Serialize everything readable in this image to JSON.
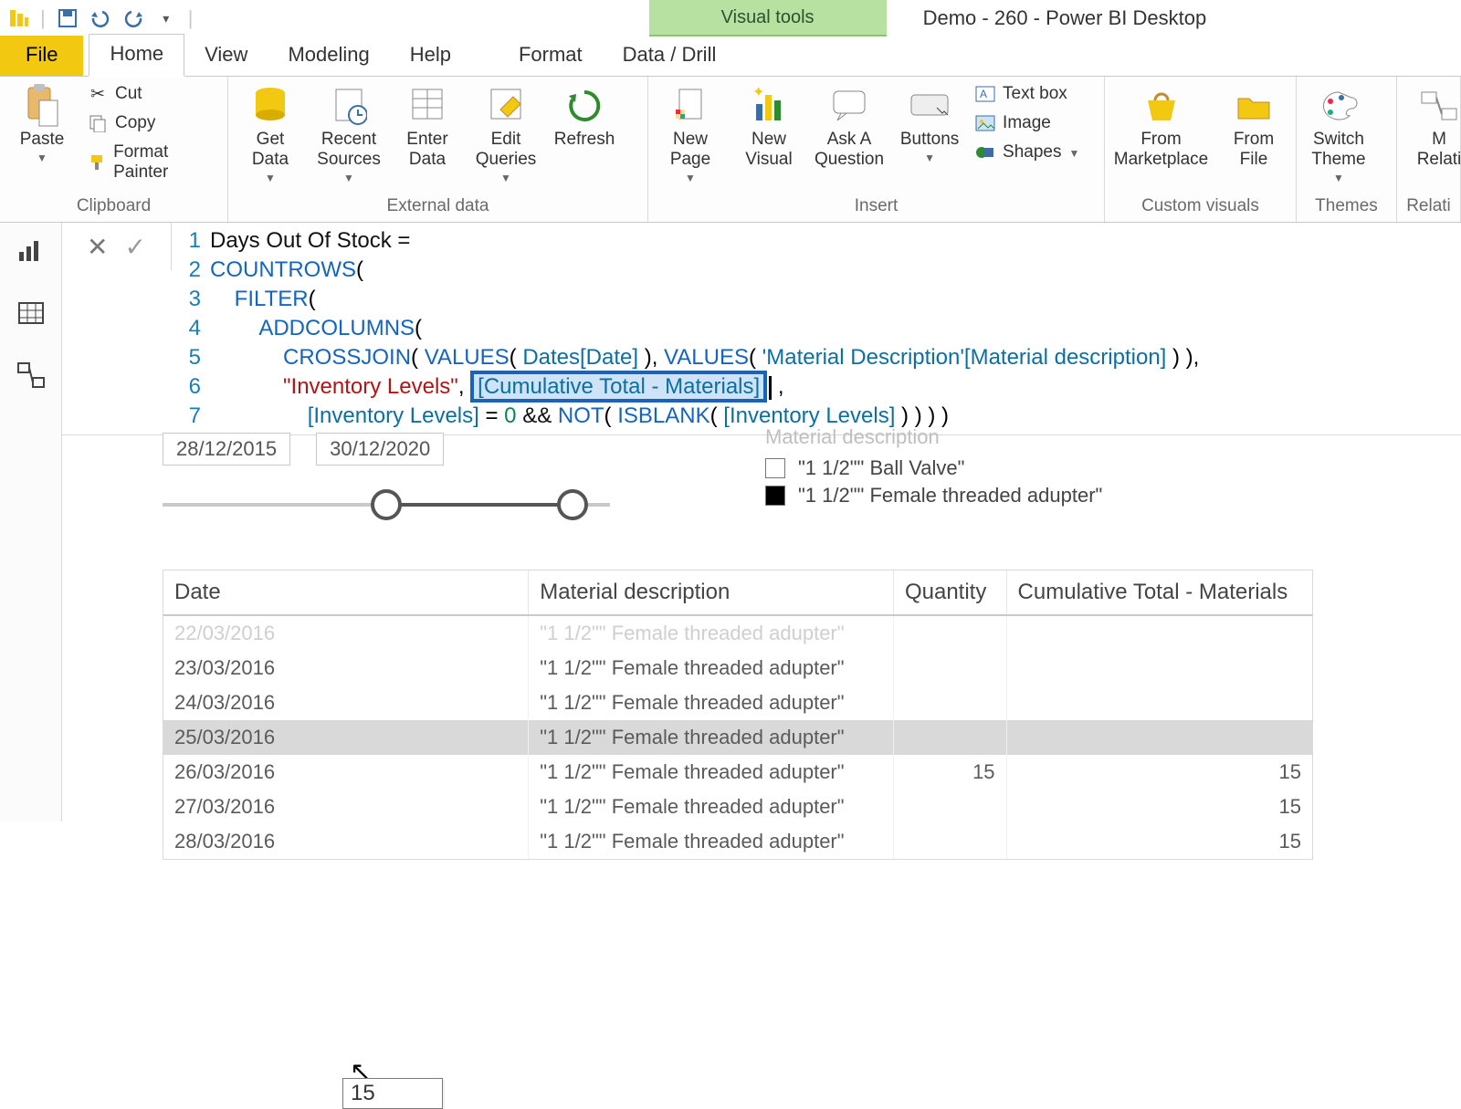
{
  "titlebar": {
    "tool_tab": "Visual tools",
    "doc_title": "Demo - 260 - Power BI Desktop"
  },
  "tabs": {
    "file": "File",
    "home": "Home",
    "view": "View",
    "modeling": "Modeling",
    "help": "Help",
    "format": "Format",
    "data_drill": "Data / Drill"
  },
  "ribbon": {
    "clipboard": {
      "label": "Clipboard",
      "paste": "Paste",
      "cut": "Cut",
      "copy": "Copy",
      "format_painter": "Format Painter"
    },
    "external": {
      "label": "External data",
      "get_data": "Get\nData",
      "recent_sources": "Recent\nSources",
      "enter_data": "Enter\nData",
      "edit_queries": "Edit\nQueries",
      "refresh": "Refresh"
    },
    "insert": {
      "label": "Insert",
      "new_page": "New\nPage",
      "new_visual": "New\nVisual",
      "ask_q": "Ask A\nQuestion",
      "buttons": "Buttons",
      "text_box": "Text box",
      "image": "Image",
      "shapes": "Shapes"
    },
    "custom_visuals": {
      "label": "Custom visuals",
      "from_marketplace": "From\nMarketplace",
      "from_file": "From\nFile"
    },
    "themes": {
      "label": "Themes",
      "switch_theme": "Switch\nTheme"
    },
    "relationships": {
      "label": "Relati",
      "manage": "M\nRelati"
    }
  },
  "formula": {
    "line1": "Days Out Of Stock =",
    "countrows": "COUNTROWS",
    "filter": "FILTER",
    "addcolumns": "ADDCOLUMNS",
    "crossjoin": "CROSSJOIN",
    "values": "VALUES",
    "dates_ref": "Dates[Date]",
    "mat_table": "'Material Description'",
    "mat_col": "[Material description]",
    "inv_label": "\"Inventory Levels\"",
    "cum_measure": "[Cumulative Total - Materials]",
    "inv_col": "[Inventory Levels]",
    "zero": "0",
    "and": "&&",
    "not": "NOT",
    "isblank": "ISBLANK"
  },
  "slicer": {
    "start": "28/12/2015",
    "end": "30/12/2020"
  },
  "legend": {
    "header": "Material description",
    "item1": "\"1 1/2\"\" Ball Valve\"",
    "item2": "\"1 1/2\"\" Female threaded adupter\""
  },
  "table": {
    "headers": {
      "date": "Date",
      "mat": "Material description",
      "qty": "Quantity",
      "cum": "Cumulative Total - Materials"
    },
    "rows": [
      {
        "date": "22/03/2016",
        "mat": "\"1 1/2\"\" Female threaded adupter\"",
        "qty": "",
        "cum": "",
        "cutoff": true
      },
      {
        "date": "23/03/2016",
        "mat": "\"1 1/2\"\" Female threaded adupter\"",
        "qty": "",
        "cum": ""
      },
      {
        "date": "24/03/2016",
        "mat": "\"1 1/2\"\" Female threaded adupter\"",
        "qty": "",
        "cum": ""
      },
      {
        "date": "25/03/2016",
        "mat": "\"1 1/2\"\" Female threaded adupter\"",
        "qty": "",
        "cum": "",
        "sel": true
      },
      {
        "date": "26/03/2016",
        "mat": "\"1 1/2\"\" Female threaded adupter\"",
        "qty": "15",
        "cum": "15"
      },
      {
        "date": "27/03/2016",
        "mat": "\"1 1/2\"\" Female threaded adupter\"",
        "qty": "",
        "cum": "15"
      },
      {
        "date": "28/03/2016",
        "mat": "\"1 1/2\"\" Female threaded adupter\"",
        "qty": "",
        "cum": "15"
      }
    ]
  },
  "tooltip": {
    "value": "15"
  }
}
